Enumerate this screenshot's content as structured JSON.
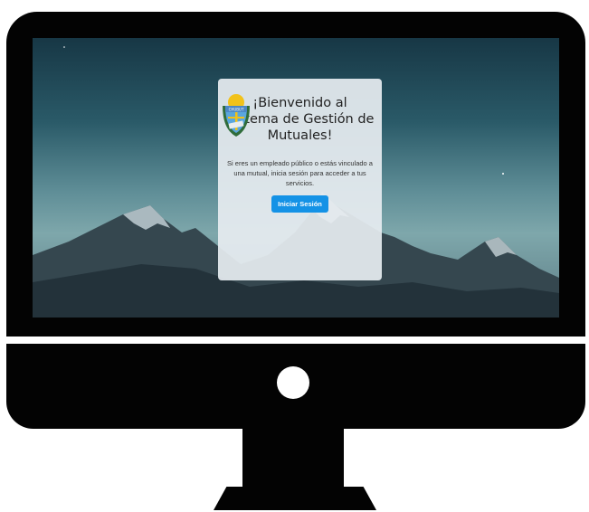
{
  "welcome": {
    "title": "¡Bienvenido al Sistema de Gestión de Mutuales!",
    "description": "Si eres un empleado público o estás vinculado a una mutual, inicia sesión para acceder a tus servicios.",
    "login_label": "Iniciar Sesión",
    "seal_text": "CHUBUT"
  },
  "colors": {
    "primary_button": "#1492e6",
    "card_background": "#e6ecf0"
  }
}
